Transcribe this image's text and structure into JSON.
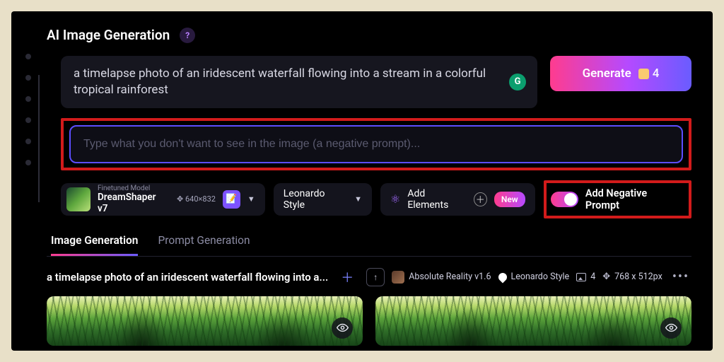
{
  "header": {
    "title": "AI Image Generation"
  },
  "prompt": {
    "text": "a timelapse photo of an iridescent waterfall flowing into a stream in a colorful tropical rainforest"
  },
  "generate": {
    "label": "Generate",
    "credits": "4"
  },
  "negative": {
    "placeholder": "Type what you don't want to see in the image (a negative prompt)..."
  },
  "model": {
    "caption": "Finetuned Model",
    "name": "DreamShaper v7",
    "dimensions": "640×832"
  },
  "style": {
    "label": "Leonardo Style"
  },
  "elements": {
    "label": "Add Elements",
    "badge": "New"
  },
  "neg_toggle": {
    "label": "Add Negative Prompt"
  },
  "tabs": {
    "active": "Image Generation",
    "other": "Prompt Generation"
  },
  "result": {
    "title": "a timelapse photo of an iridescent waterfall flowing into a...",
    "model": "Absolute Reality v1.6",
    "style": "Leonardo Style",
    "count": "4",
    "dimensions": "768 x 512px"
  }
}
